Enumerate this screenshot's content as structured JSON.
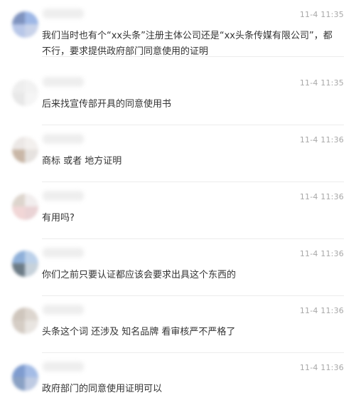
{
  "comments": [
    {
      "time": "11-4 11:35",
      "text": "我们当时也有个“xx头条”注册主体公司还是“xx头条传媒有限公司”，都不行，要求提供政府部门同意使用的证明",
      "avatar_colors": [
        "#7f93bf",
        "#9db7e6",
        "#b8c7e8",
        "#c9d3ea"
      ]
    },
    {
      "time": "11-4 11:35",
      "text": "后来找宣传部开具的同意使用书",
      "avatar_colors": [
        "#eeeeee",
        "#f2f2f2",
        "#e8e8e8",
        "#f5f5f5"
      ]
    },
    {
      "time": "11-4 11:36",
      "text": "商标 或者 地方证明",
      "avatar_colors": [
        "#ece8e6",
        "#f3f0ee",
        "#c9b7a7",
        "#e6e2df"
      ]
    },
    {
      "time": "11-4 11:36",
      "text": "有用吗?",
      "avatar_colors": [
        "#ddd5cd",
        "#f2eeee",
        "#f1d6d6",
        "#ead3d5"
      ]
    },
    {
      "time": "11-4 11:36",
      "text": "你们之前只要认证都应该会要求出具这个东西的",
      "avatar_colors": [
        "#8fb0d9",
        "#bcd1ea",
        "#6c7b86",
        "#c7d2db"
      ]
    },
    {
      "time": "11-4 11:36",
      "text": "头条这个词 还涉及 知名品牌 看审核严不严格了",
      "avatar_colors": [
        "#cfc6bd",
        "#ddd6cf",
        "#d5cdc5",
        "#e9e5e1"
      ]
    },
    {
      "time": "11-4 11:36",
      "text": "政府部门的同意使用证明可以",
      "avatar_colors": [
        "#7f9ccf",
        "#a4bce6",
        "#8aa1c4",
        "#bfcbe3"
      ]
    }
  ]
}
